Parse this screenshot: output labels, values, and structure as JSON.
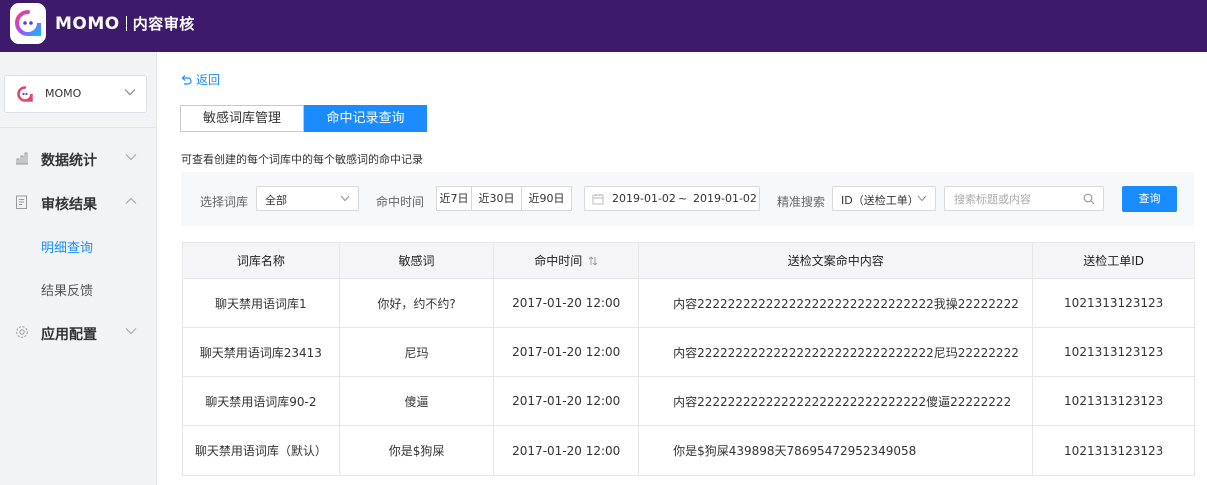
{
  "header": {
    "brand": "MOMO",
    "subtitle": "内容审核",
    "bg_color": "#3d1a6b"
  },
  "sidebar": {
    "app_select": {
      "value": "MOMO"
    },
    "menu": [
      {
        "label": "数据统计",
        "icon": "bar-chart-icon",
        "expanded": false
      },
      {
        "label": "审核结果",
        "icon": "document-icon",
        "expanded": true,
        "children": [
          {
            "label": "明细查询",
            "active": true
          },
          {
            "label": "结果反馈",
            "active": false
          }
        ]
      },
      {
        "label": "应用配置",
        "icon": "gear-icon",
        "expanded": false
      }
    ]
  },
  "main": {
    "back_label": "返回",
    "tabs": [
      {
        "label": "敏感词库管理",
        "active": false
      },
      {
        "label": "命中记录查询",
        "active": true
      }
    ],
    "hint": "可查看创建的每个词库中的每个敏感词的命中记录",
    "filters": {
      "library_label": "选择词库",
      "library_value": "全部",
      "time_label": "命中时间",
      "ranges": [
        "近7日",
        "近30日",
        "近90日"
      ],
      "date_start": "2019-01-02",
      "date_sep": "~",
      "date_end": "2019-01-02",
      "precise_label": "精准搜索",
      "precise_value": "ID（送检工单）",
      "search_placeholder": "搜索标题或内容",
      "query_button": "查询"
    },
    "table": {
      "headers": [
        "词库名称",
        "敏感词",
        "命中时间",
        "送检文案命中内容",
        "送检工单ID"
      ],
      "rows": [
        [
          "聊天禁用语词库1",
          "你好，约不约?",
          "2017-01-20 12:00",
          "内容2222222222222222222222222222222我操22222222",
          "1021313123123"
        ],
        [
          "聊天禁用语词库23413",
          "尼玛",
          "2017-01-20 12:00",
          "内容2222222222222222222222222222222尼玛22222222",
          "1021313123123"
        ],
        [
          "聊天禁用语词库90-2",
          "傻逼",
          "2017-01-20 12:00",
          "内容222222222222222222222222222222傻逼22222222",
          "1021313123123"
        ],
        [
          "聊天禁用语词库（默认）",
          "你是$狗屎",
          "2017-01-20 12:00",
          "你是$狗屎439898天78695472952349058",
          "1021313123123"
        ]
      ]
    },
    "accent_color": "#1a8cff"
  }
}
